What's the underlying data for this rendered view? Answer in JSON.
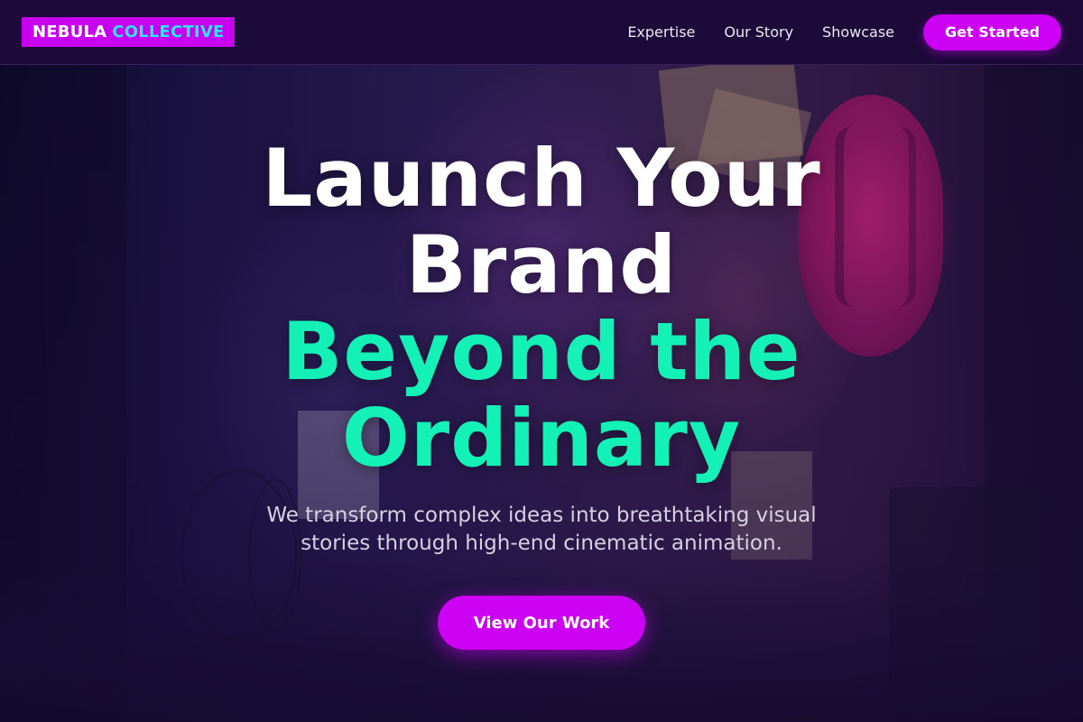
{
  "colors": {
    "brand_magenta": "#cc00f2",
    "accent_teal": "#14f1b6",
    "logo_cyan": "#33e2ff",
    "nav_background": "#1c0a38"
  },
  "brand": {
    "name_part1": "NEBULA",
    "name_part2": "COLLECTIVE"
  },
  "nav": {
    "links": [
      "Expertise",
      "Our Story",
      "Showcase"
    ],
    "cta_label": "Get Started"
  },
  "hero": {
    "headline_line1": "Launch Your",
    "headline_line2": "Brand",
    "headline_accent_line1": "Beyond the",
    "headline_accent_line2": "Ordinary",
    "subtitle": "We transform complex ideas into breathtaking visual stories through high-end cinematic animation.",
    "cta_label": "View Our Work",
    "background_image": "neon-alley-photo"
  }
}
